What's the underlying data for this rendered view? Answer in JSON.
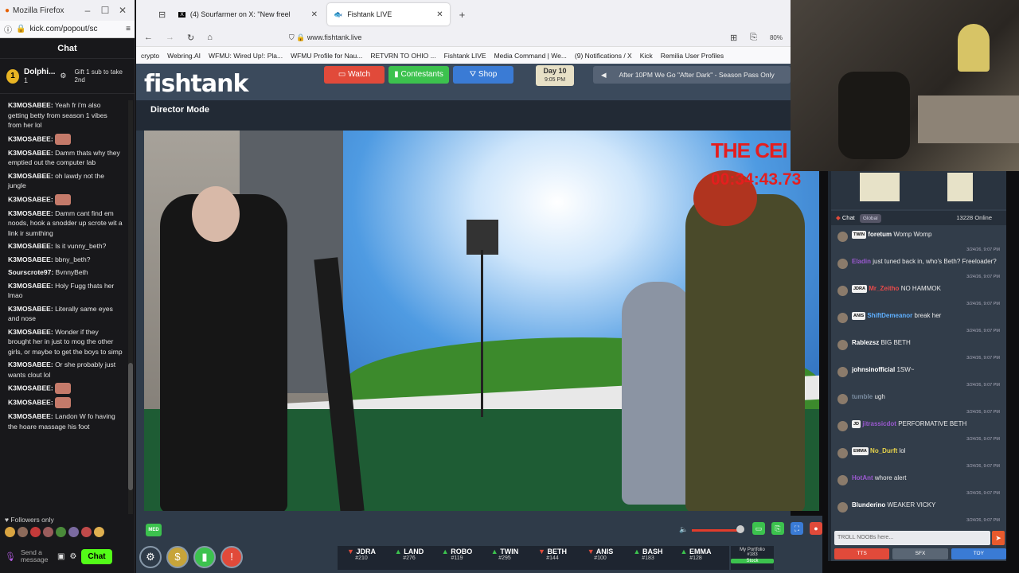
{
  "popout": {
    "window_title": "Mozilla Firefox",
    "url": "kick.com/popout/sc",
    "chat_header": "Chat",
    "pinned": {
      "name": "Dolphi...",
      "count": "1",
      "gift_text": "Gift 1 sub to take 2nd"
    },
    "messages": [
      {
        "user": "K3MOSABEE:",
        "text": "Yeah fr i'm also getting betty from season 1 vibes from her lol"
      },
      {
        "user": "K3MOSABEE:",
        "text": "",
        "emote": true
      },
      {
        "user": "K3MOSABEE:",
        "text": "Damm thats why they emptied out the computer lab"
      },
      {
        "user": "K3MOSABEE:",
        "text": "oh lawdy not the jungle"
      },
      {
        "user": "K3MOSABEE:",
        "text": "",
        "emote": true
      },
      {
        "user": "K3MOSABEE:",
        "text": "Damm cant find em noods, hook a snodder up scrote wit a link ir sumthing"
      },
      {
        "user": "K3MOSABEE:",
        "text": "Is it vunny_beth?"
      },
      {
        "user": "K3MOSABEE:",
        "text": "bbny_beth?"
      },
      {
        "user": "Sourscrote97:",
        "text": "BvnnyBeth"
      },
      {
        "user": "K3MOSABEE:",
        "text": "Holy Fugg thats her lmao"
      },
      {
        "user": "K3MOSABEE:",
        "text": "Literally same eyes and nose"
      },
      {
        "user": "K3MOSABEE:",
        "text": "Wonder if they brought her in just to mog the other girls, or maybe to get the boys to simp"
      },
      {
        "user": "K3MOSABEE:",
        "text": "Or she probably just wants clout lol"
      },
      {
        "user": "K3MOSABEE:",
        "text": "",
        "emote": true
      },
      {
        "user": "K3MOSABEE:",
        "text": "",
        "emote": true
      },
      {
        "user": "K3MOSABEE:",
        "text": "Landon W fo having the hoare massage his foot"
      }
    ],
    "followers_only": "Followers only",
    "input_placeholder": "Send a message",
    "chat_button": "Chat"
  },
  "browser": {
    "tabs": [
      {
        "label": "(4) Sourfarmer on X: \"New freel",
        "active": false
      },
      {
        "label": "Fishtank LIVE",
        "active": true
      }
    ],
    "url": "www.fishtank.live",
    "zoom": "80%",
    "bookmarks": [
      "crypto",
      "Webring.AI",
      "WFMU: Wired Up!: Pla...",
      "WFMU Profile for Nau...",
      "RETVRN TO OHIO ...",
      "Fishtank LIVE",
      "Media Command | We...",
      "(9) Notifications / X",
      "Kick",
      "Remilia User Profiles"
    ]
  },
  "fishtank": {
    "logo": "fishtank",
    "nav": {
      "watch": "Watch",
      "contestants": "Contestants",
      "shop": "Shop"
    },
    "day": {
      "label": "Day 10",
      "time": "9:05 PM"
    },
    "ticker": "After 10PM We Go \"After Dark\" - Season Pass Only",
    "director_mode": "Director Mode",
    "video_overlay": {
      "title": "THE CEI",
      "timer": "00:34:43.73"
    },
    "quality": "MED",
    "roster": [
      {
        "name": "JDRA",
        "votes": "#210",
        "dir": "down"
      },
      {
        "name": "LAND",
        "votes": "#276",
        "dir": "up"
      },
      {
        "name": "ROBO",
        "votes": "#119",
        "dir": "up"
      },
      {
        "name": "TWIN",
        "votes": "#295",
        "dir": "up"
      },
      {
        "name": "BETH",
        "votes": "#144",
        "dir": "down"
      },
      {
        "name": "ANIS",
        "votes": "#100",
        "dir": "down"
      },
      {
        "name": "BASH",
        "votes": "#183",
        "dir": "up"
      },
      {
        "name": "EMMA",
        "votes": "#128",
        "dir": "up"
      }
    ],
    "portfolio": {
      "label": "My Portfolio",
      "value": "#183",
      "stock": "Stock"
    },
    "colors": {
      "watch": "#e14a3a",
      "contestants": "#3cc24e",
      "shop": "#3a7bd5",
      "accent_green": "#53fc18"
    }
  },
  "sidechat": {
    "title": "Chat",
    "global": "Global",
    "online": "13228 Online",
    "messages": [
      {
        "tag": "TWIN",
        "user": "foretum",
        "text": "Womp Womp",
        "time": "3/24/26, 9:07 PM",
        "ucolor": "#ffffff"
      },
      {
        "tag": "",
        "user": "Eladin",
        "text": "just tuned back in, who's Beth? Freeloader?",
        "time": "3/24/26, 9:07 PM",
        "ucolor": "#9b59d0"
      },
      {
        "tag": "JDRA",
        "user": "Mr_Zeitho",
        "text": "NO HAMMOK",
        "time": "3/24/26, 9:07 PM",
        "ucolor": "#e84a4a"
      },
      {
        "tag": "ANIS",
        "user": "ShiftDemeanor",
        "text": "break her",
        "time": "3/24/26, 9:07 PM",
        "ucolor": "#5fb0ff"
      },
      {
        "tag": "",
        "user": "Rablezsz",
        "text": "BIG BETH",
        "time": "3/24/26, 9:07 PM",
        "ucolor": "#ffffff"
      },
      {
        "tag": "",
        "user": "johnsinofficial",
        "text": "1SW~",
        "time": "3/24/26, 9:07 PM",
        "ucolor": "#ffffff"
      },
      {
        "tag": "",
        "user": "tumble",
        "text": "ugh",
        "time": "3/24/26, 9:07 PM",
        "ucolor": "#7a8ca0"
      },
      {
        "tag": "JD",
        "user": "jitrassicdot",
        "text": "PERFORMATIVE BETH",
        "time": "3/24/26, 9:07 PM",
        "ucolor": "#9b59d0"
      },
      {
        "tag": "EMMA",
        "user": "No_Durft",
        "text": "lol",
        "time": "3/24/26, 9:07 PM",
        "ucolor": "#e8d44a"
      },
      {
        "tag": "",
        "user": "HotAnt",
        "text": "whore alert",
        "time": "3/24/26, 9:07 PM",
        "ucolor": "#9b59d0"
      },
      {
        "tag": "",
        "user": "Blunderino",
        "text": "WEAKER VICKY",
        "time": "3/24/26, 9:07 PM",
        "ucolor": "#ffffff"
      }
    ],
    "input_placeholder": "TROLL NOOBs here...",
    "buttons": [
      "TTS",
      "SFX",
      "TOY"
    ]
  }
}
